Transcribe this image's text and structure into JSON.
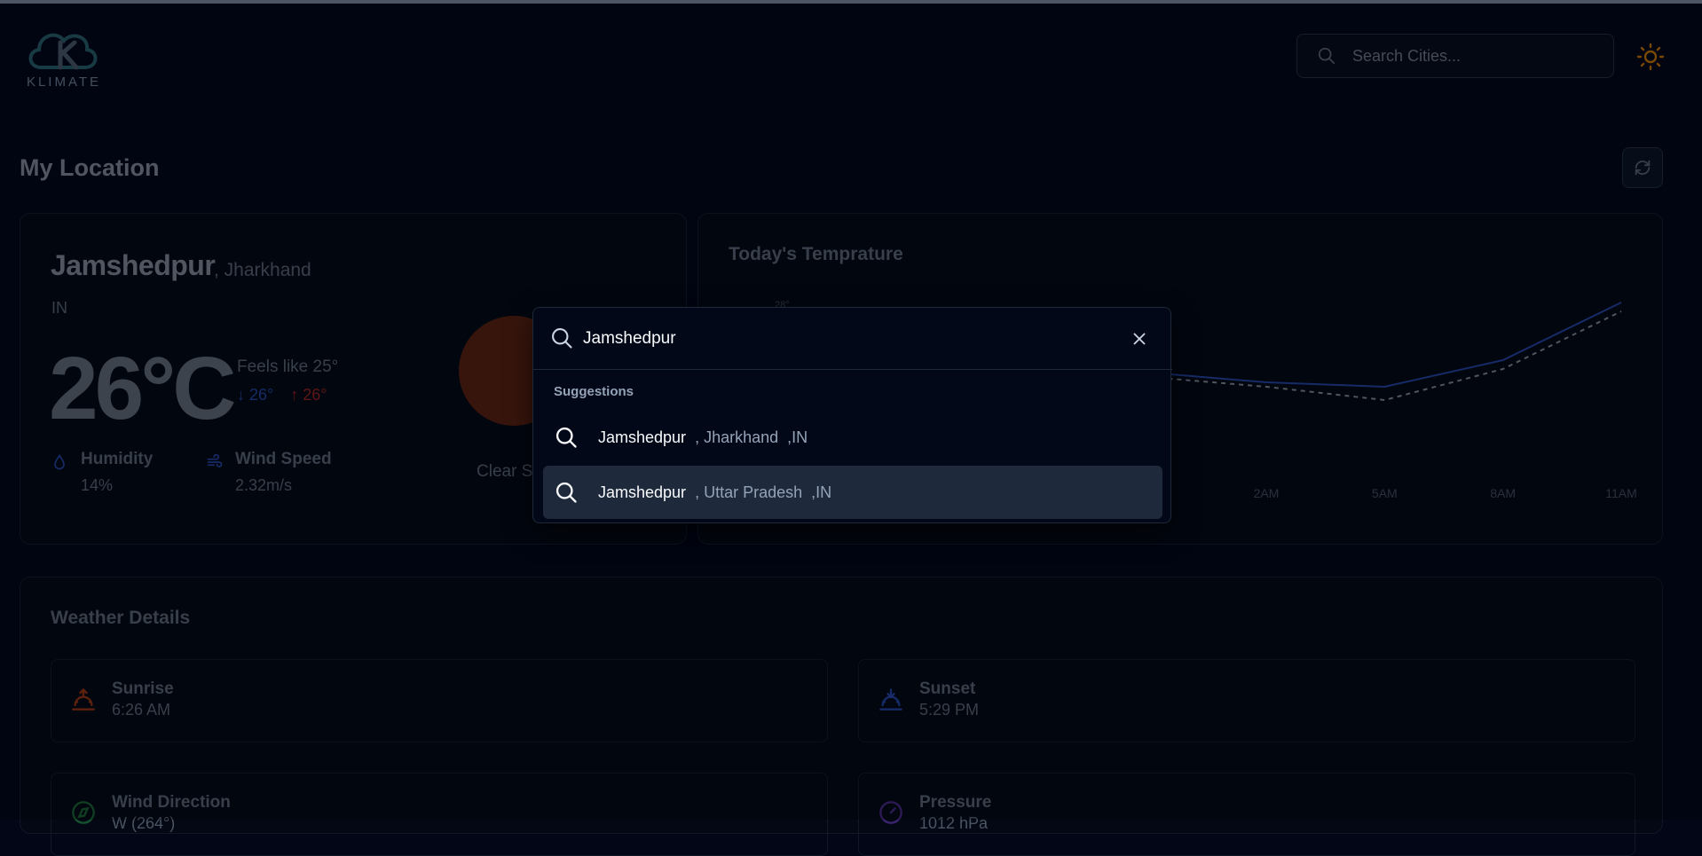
{
  "header": {
    "logo_text": "KLIMATE",
    "search_placeholder": "Search Cities...",
    "theme_icon": "sun-icon"
  },
  "section": {
    "title": "My Location"
  },
  "weather": {
    "city": "Jamshedpur",
    "state": ", Jharkhand",
    "country": "IN",
    "temp": "26°C",
    "feels_like": "Feels like 25°",
    "min": "↓ 26°",
    "max": "↑ 26°",
    "humidity_label": "Humidity",
    "humidity_value": "14%",
    "wind_label": "Wind Speed",
    "wind_value": "2.32m/s",
    "description": "Clear S"
  },
  "chart": {
    "title": "Today's Temprature",
    "y_tick": "28°",
    "x_ticks": [
      "2AM",
      "5AM",
      "8AM",
      "11AM"
    ]
  },
  "chart_data": {
    "type": "line",
    "title": "Today's Temprature",
    "x": [
      "2AM",
      "5AM",
      "8AM",
      "11AM"
    ],
    "series": [
      {
        "values": [
          26,
          25.9,
          26.5,
          27.8
        ]
      },
      {
        "values": [
          25.9,
          25.6,
          26.3,
          27.6
        ]
      }
    ],
    "ylim": [
      24,
      28
    ]
  },
  "details": {
    "title": "Weather Details",
    "items": [
      {
        "label": "Sunrise",
        "value": "6:26 AM",
        "icon": "sunrise-icon",
        "color": "#f97316"
      },
      {
        "label": "Sunset",
        "value": "5:29 PM",
        "icon": "sunset-icon",
        "color": "#3b82f6"
      },
      {
        "label": "Wind Direction",
        "value": "W (264°)",
        "icon": "compass-icon",
        "color": "#22c55e"
      },
      {
        "label": "Pressure",
        "value": "1012 hPa",
        "icon": "gauge-icon",
        "color": "#8b5cf6"
      }
    ]
  },
  "dialog": {
    "query": "Jamshedpur",
    "suggestions_heading": "Suggestions",
    "suggestions": [
      {
        "name": "Jamshedpur",
        "rest": ", Jharkhand  ,IN",
        "selected": false
      },
      {
        "name": "Jamshedpur",
        "rest": ", Uttar Pradesh  ,IN",
        "selected": true
      }
    ]
  },
  "colors": {
    "background": "#020617",
    "accent_sun": "#eab308",
    "max_red": "#ef4444",
    "min_blue": "#3b82f6"
  }
}
